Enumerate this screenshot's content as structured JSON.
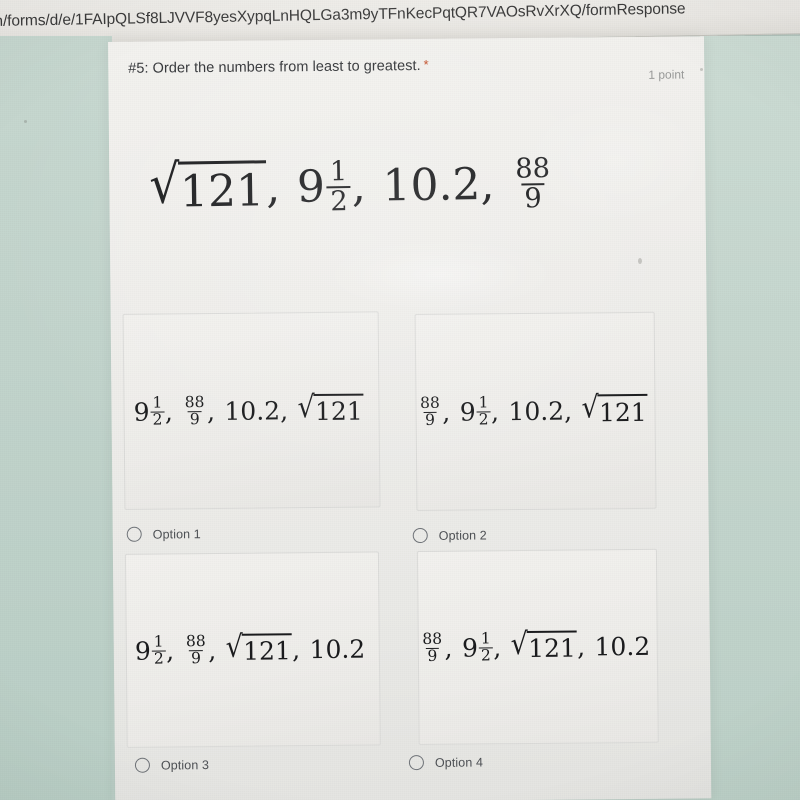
{
  "browser": {
    "url_text": "n/forms/d/e/1FAIpQLSf8LJVVF8yesXypqLnHQLGa3m9yTFnKecPqtQR7VAOsRvXrXQ/formResponse"
  },
  "form": {
    "question_title": "#5: Order the numbers from least to greatest.",
    "required_marker": "*",
    "points_label": "1 point",
    "prompt_expression": {
      "tokens": [
        {
          "kind": "sqrt",
          "radicand": "121",
          "sep": ","
        },
        {
          "kind": "mixed",
          "whole": "9",
          "num": "1",
          "den": "2",
          "sep": ","
        },
        {
          "kind": "plain",
          "text": "10.2",
          "sep": ","
        },
        {
          "kind": "frac",
          "num": "88",
          "den": "9",
          "sep": ""
        }
      ]
    },
    "options": [
      {
        "label": "Option 1",
        "selected": false,
        "expression": {
          "tokens": [
            {
              "kind": "mixed",
              "whole": "9",
              "num": "1",
              "den": "2",
              "sep": ","
            },
            {
              "kind": "frac",
              "num": "88",
              "den": "9",
              "sep": ","
            },
            {
              "kind": "plain",
              "text": "10.2",
              "sep": ","
            },
            {
              "kind": "sqrt",
              "radicand": "121",
              "sep": ""
            }
          ]
        }
      },
      {
        "label": "Option 2",
        "selected": false,
        "expression": {
          "tokens": [
            {
              "kind": "frac",
              "num": "88",
              "den": "9",
              "sep": ","
            },
            {
              "kind": "mixed",
              "whole": "9",
              "num": "1",
              "den": "2",
              "sep": ","
            },
            {
              "kind": "plain",
              "text": "10.2",
              "sep": ","
            },
            {
              "kind": "sqrt",
              "radicand": "121",
              "sep": ""
            }
          ]
        }
      },
      {
        "label": "Option 3",
        "selected": false,
        "expression": {
          "tokens": [
            {
              "kind": "mixed",
              "whole": "9",
              "num": "1",
              "den": "2",
              "sep": ","
            },
            {
              "kind": "frac",
              "num": "88",
              "den": "9",
              "sep": ","
            },
            {
              "kind": "sqrt",
              "radicand": "121",
              "sep": ","
            },
            {
              "kind": "plain",
              "text": "10.2",
              "sep": ""
            }
          ]
        }
      },
      {
        "label": "Option 4",
        "selected": false,
        "expression": {
          "tokens": [
            {
              "kind": "frac",
              "num": "88",
              "den": "9",
              "sep": ","
            },
            {
              "kind": "mixed",
              "whole": "9",
              "num": "1",
              "den": "2",
              "sep": ","
            },
            {
              "kind": "sqrt",
              "radicand": "121",
              "sep": ","
            },
            {
              "kind": "plain",
              "text": "10.2",
              "sep": ""
            }
          ]
        }
      }
    ]
  },
  "colors": {
    "desktop_mint": "#c2d4cc",
    "card_white": "#f0efec",
    "text_dark": "#1b1c1e",
    "required_red": "#c5542f",
    "muted_grey": "#9a9b9a",
    "radio_outline": "#6f7378"
  }
}
